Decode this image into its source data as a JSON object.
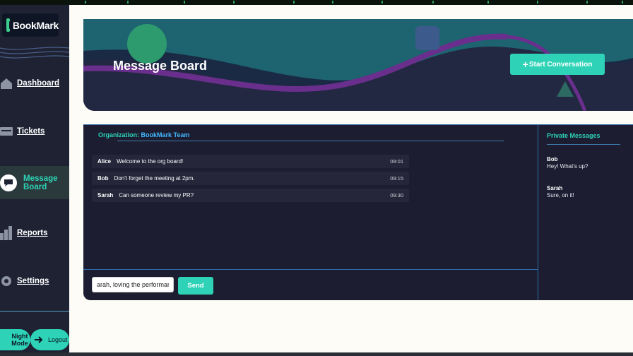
{
  "app": {
    "name": "BookMark"
  },
  "sidebar": {
    "items": [
      {
        "label": "Dashboard",
        "icon": "home-icon"
      },
      {
        "label": "Tickets",
        "icon": "ticket-icon"
      },
      {
        "label": "Message Board",
        "icon": "chat-icon",
        "active": true
      },
      {
        "label": "Reports",
        "icon": "bar-chart-icon"
      },
      {
        "label": "Settings",
        "icon": "gear-icon"
      }
    ],
    "night_mode_label": "Night Mode",
    "logout_label": "Logout"
  },
  "header": {
    "title": "Message Board",
    "start_button_label": "Start Conversation"
  },
  "board": {
    "org_prefix": "Organization:",
    "org_name": "BookMark Team",
    "messages": [
      {
        "author": "Alice",
        "text": "Welcome to the org board!",
        "time": "09:01"
      },
      {
        "author": "Bob",
        "text": "Don't forget the meeting at 2pm.",
        "time": "09:15"
      },
      {
        "author": "Sarah",
        "text": "Can someone review my PR?",
        "time": "09:30"
      }
    ],
    "input_value": "arah, loving the performan",
    "send_label": "Send"
  },
  "private_messages": {
    "title": "Private Messages",
    "items": [
      {
        "name": "Bob",
        "text": "Hey! What's up?"
      },
      {
        "name": "Sarah",
        "text": "Sure, on it!"
      }
    ]
  },
  "colors": {
    "accent": "#2ed3b7",
    "sidebar": "#1e2233",
    "board": "#1c1d31",
    "link": "#42b8ff"
  }
}
